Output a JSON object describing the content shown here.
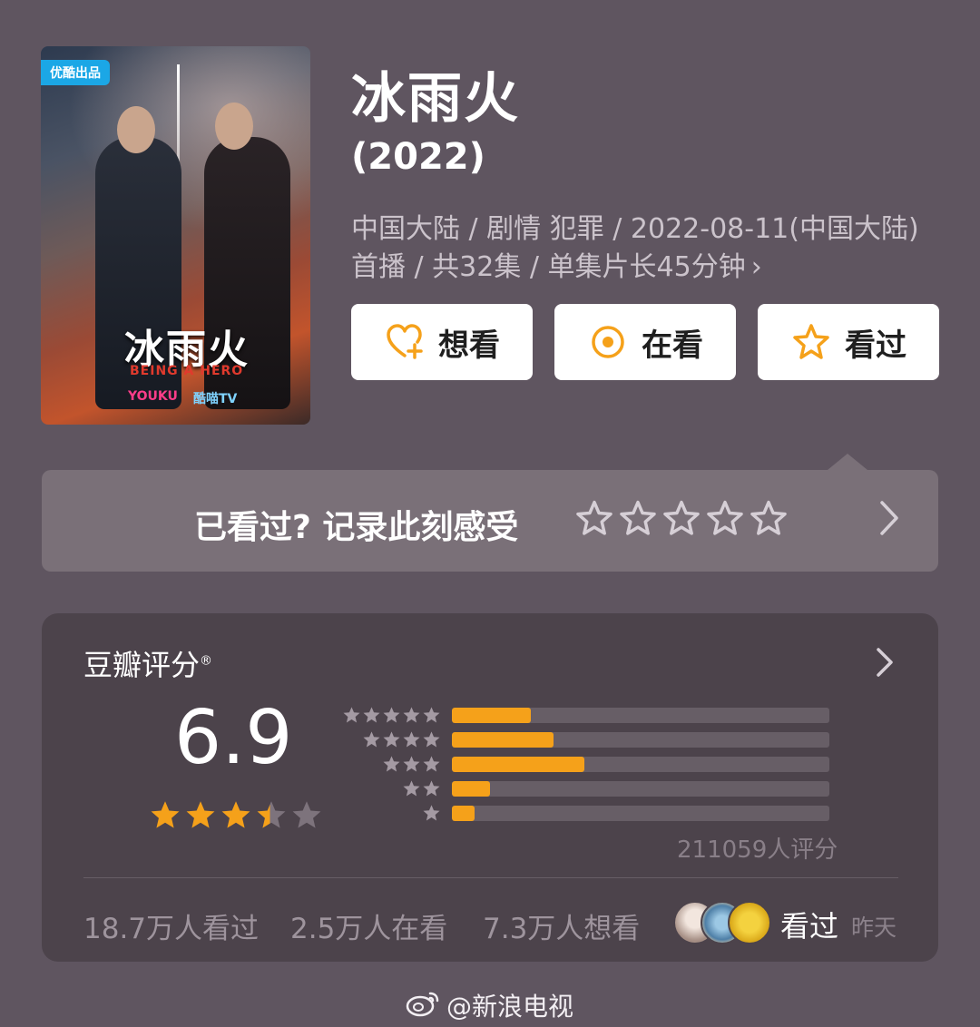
{
  "poster": {
    "badge": "优酷出品",
    "title": "冰雨火",
    "subtitle": "BEING A HERO",
    "brand_youku": "YOUKU",
    "brand_other": "酷喵TV"
  },
  "show": {
    "title": "冰雨火",
    "year": "(2022)",
    "meta": "中国大陆 / 剧情 犯罪 / 2022-08-11(中国大陆)首播 / 共32集 / 单集片长45分钟",
    "meta_chevron": "›"
  },
  "actions": {
    "want_label": "想看",
    "watching_label": "在看",
    "watched_label": "看过"
  },
  "rate_prompt": {
    "text": "已看过? 记录此刻感受",
    "star_count": 5
  },
  "rating": {
    "title": "豆瓣评分",
    "registered": "®",
    "score": "6.9",
    "stars_filled_fraction": 0.69,
    "distribution": [
      {
        "stars": 5,
        "fraction": 0.21
      },
      {
        "stars": 4,
        "fraction": 0.27
      },
      {
        "stars": 3,
        "fraction": 0.35
      },
      {
        "stars": 2,
        "fraction": 0.1
      },
      {
        "stars": 1,
        "fraction": 0.06
      }
    ],
    "count_text": "211059人评分",
    "stats": {
      "watched": "18.7万人看过",
      "watching": "2.5万人在看",
      "want": "7.3万人想看"
    },
    "friend_action": "看过",
    "friend_time": "昨天"
  },
  "watermark": "@新浪电视",
  "colors": {
    "background": "#5f5560",
    "accent_orange": "#f5a11a",
    "card_bg": "#4c434b"
  }
}
